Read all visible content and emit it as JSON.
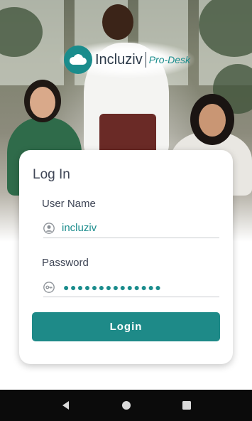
{
  "brand": {
    "name": "Incluziv",
    "product": "Pro-Desk",
    "accent_color": "#1a8c8c"
  },
  "login_card": {
    "title": "Log In",
    "username_label": "User Name",
    "username_value": "incluziv",
    "username_icon": "user-circle-icon",
    "password_label": "Password",
    "password_value": "●●●●●●●●●●●●●●",
    "password_icon": "key-icon",
    "login_button_label": "Login"
  },
  "system_nav": {
    "back_icon": "back-triangle-icon",
    "home_icon": "home-circle-icon",
    "recents_icon": "recents-square-icon"
  }
}
